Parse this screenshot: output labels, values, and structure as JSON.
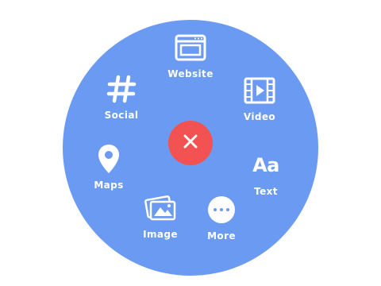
{
  "menu": {
    "items": [
      {
        "id": "website",
        "label": "Website",
        "icon": "browser-window-icon"
      },
      {
        "id": "social",
        "label": "Social",
        "icon": "hashtag-icon"
      },
      {
        "id": "video",
        "label": "Video",
        "icon": "film-play-icon"
      },
      {
        "id": "maps",
        "label": "Maps",
        "icon": "map-pin-icon"
      },
      {
        "id": "text",
        "label": "Text",
        "icon": "text-aa-icon",
        "glyph": "Aa"
      },
      {
        "id": "image",
        "label": "Image",
        "icon": "image-stack-icon"
      },
      {
        "id": "more",
        "label": "More",
        "icon": "more-dots-icon"
      }
    ],
    "close_icon": "close-icon"
  },
  "colors": {
    "menu_background": "#6b9af3",
    "close_button": "#f25252",
    "foreground": "#ffffff"
  }
}
